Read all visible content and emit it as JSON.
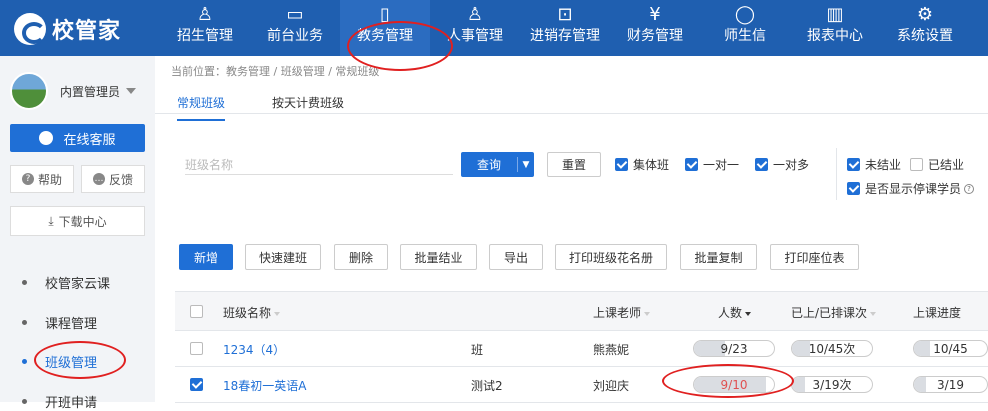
{
  "app": {
    "name": "校管家"
  },
  "nav": {
    "items": [
      {
        "label": "招生管理",
        "icon": "user-plus-icon",
        "glyph": "♙"
      },
      {
        "label": "前台业务",
        "icon": "monitor-icon",
        "glyph": "▭"
      },
      {
        "label": "教务管理",
        "icon": "book-icon",
        "glyph": "▯"
      },
      {
        "label": "人事管理",
        "icon": "person-icon",
        "glyph": "♙"
      },
      {
        "label": "进销存管理",
        "icon": "inbox-icon",
        "glyph": "⊡"
      },
      {
        "label": "财务管理",
        "icon": "yen-shield-icon",
        "glyph": "¥"
      },
      {
        "label": "师生信",
        "icon": "chat-icon",
        "glyph": "◯"
      },
      {
        "label": "报表中心",
        "icon": "chart-icon",
        "glyph": "▥"
      },
      {
        "label": "系统设置",
        "icon": "gear-icon",
        "glyph": "⚙"
      }
    ]
  },
  "sidebar": {
    "user": "内置管理员",
    "service": "在线客服",
    "help": "帮助",
    "feedback": "反馈",
    "download": "下载中心",
    "items": [
      {
        "label": "校管家云课"
      },
      {
        "label": "课程管理"
      },
      {
        "label": "班级管理"
      },
      {
        "label": "开班申请"
      }
    ]
  },
  "breadcrumb": "当前位置：教务管理 / 班级管理 / 常规班级",
  "tabs": [
    {
      "label": "常规班级"
    },
    {
      "label": "按天计费班级"
    }
  ],
  "filters": {
    "class_name_placeholder": "班级名称",
    "query": "查询",
    "reset": "重置",
    "group_class": "集体班",
    "one_to_one": "一对一",
    "one_to_many": "一对多",
    "not_finished": "未结业",
    "finished": "已结业",
    "show_suspended": "是否显示停课学员"
  },
  "toolbar": {
    "add": "新增",
    "quick_create": "快速建班",
    "delete": "删除",
    "batch_finish": "批量结业",
    "export": "导出",
    "print_roster": "打印班级花名册",
    "batch_copy": "批量复制",
    "print_seats": "打印座位表"
  },
  "table": {
    "headers": {
      "name": "班级名称",
      "teacher": "上课老师",
      "count": "人数",
      "sessions": "已上/已排课次",
      "progress": "上课进度"
    },
    "rows": [
      {
        "name": "1234（4）",
        "partial": "班",
        "teacher": "熊燕妮",
        "count": "9/23",
        "count_ratio": 0.39,
        "sessions": "10/45次",
        "sessions_ratio": 0.22,
        "progress": "10/45",
        "progress_ratio": 0.22,
        "checked": false
      },
      {
        "name": "18春初一英语A",
        "partial": "测试2",
        "teacher": "刘迎庆",
        "count": "9/10",
        "count_ratio": 0.9,
        "sessions": "3/19次",
        "sessions_ratio": 0.16,
        "progress": "3/19",
        "progress_ratio": 0.16,
        "checked": true
      }
    ]
  },
  "colors": {
    "brand": "#1f5fb0",
    "accent": "#1f6fd6",
    "annotation": "#e02020",
    "full_count": "#e05050"
  }
}
